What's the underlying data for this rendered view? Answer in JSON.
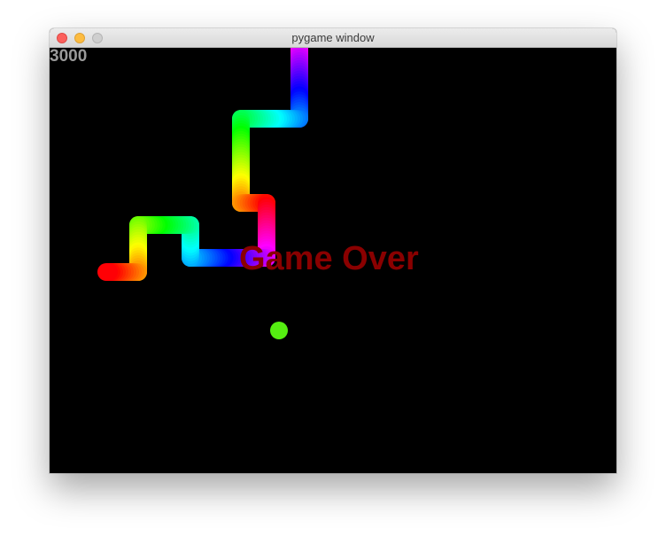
{
  "window": {
    "title": "pygame window"
  },
  "game": {
    "score": "3000",
    "game_over_text": "Game Over",
    "colors": {
      "background": "#000000",
      "score_text": "#9a9a9a",
      "game_over_text": "#8a0000",
      "food": "#55ee11"
    },
    "snake_colors": "rainbow gradient"
  }
}
